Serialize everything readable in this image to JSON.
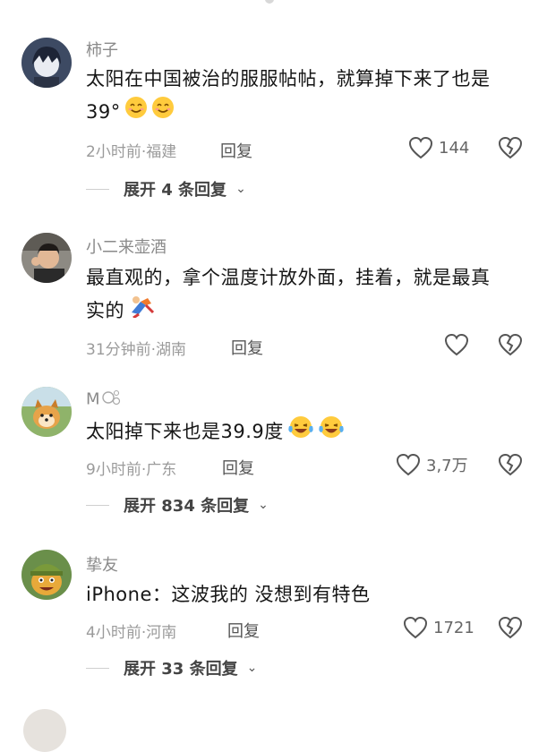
{
  "comments": [
    {
      "username": "柿子",
      "text_line1": "太阳在中国被治的服服帖帖，就算掉下来了也是",
      "text_line2": "39°",
      "time_location": "2小时前·福建",
      "reply_label": "回复",
      "like_count": "144",
      "expand_label": "展开 4 条回复"
    },
    {
      "username": "小二来壶酒",
      "text_line1": "最直观的，拿个温度计放外面，挂着，就是最真",
      "text_line2": "实的",
      "time_location": "31分钟前·湖南",
      "reply_label": "回复",
      "like_count": ""
    },
    {
      "username": "M",
      "text_line1": "太阳掉下来也是39.9度",
      "time_location": "9小时前·广东",
      "reply_label": "回复",
      "like_count": "3,7万",
      "expand_label": "展开 834 条回复"
    },
    {
      "username": "挚友",
      "text_line1": "iPhone：这波我的 没想到有特色",
      "time_location": "4小时前·河南",
      "reply_label": "回复",
      "like_count": "1721",
      "expand_label": "展开 33 条回复"
    }
  ],
  "icons": {
    "like": "heart-outline-icon",
    "dislike": "broken-heart-icon",
    "expand": "chevron-down-icon",
    "emoji_smile": "smiling-face-emoji",
    "emoji_laugh": "tears-of-joy-emoji",
    "emoji_fall": "falling-person-emoji"
  },
  "colors": {
    "meta": "#9b9b9b",
    "username": "#8a8a8a",
    "text": "#161616"
  }
}
